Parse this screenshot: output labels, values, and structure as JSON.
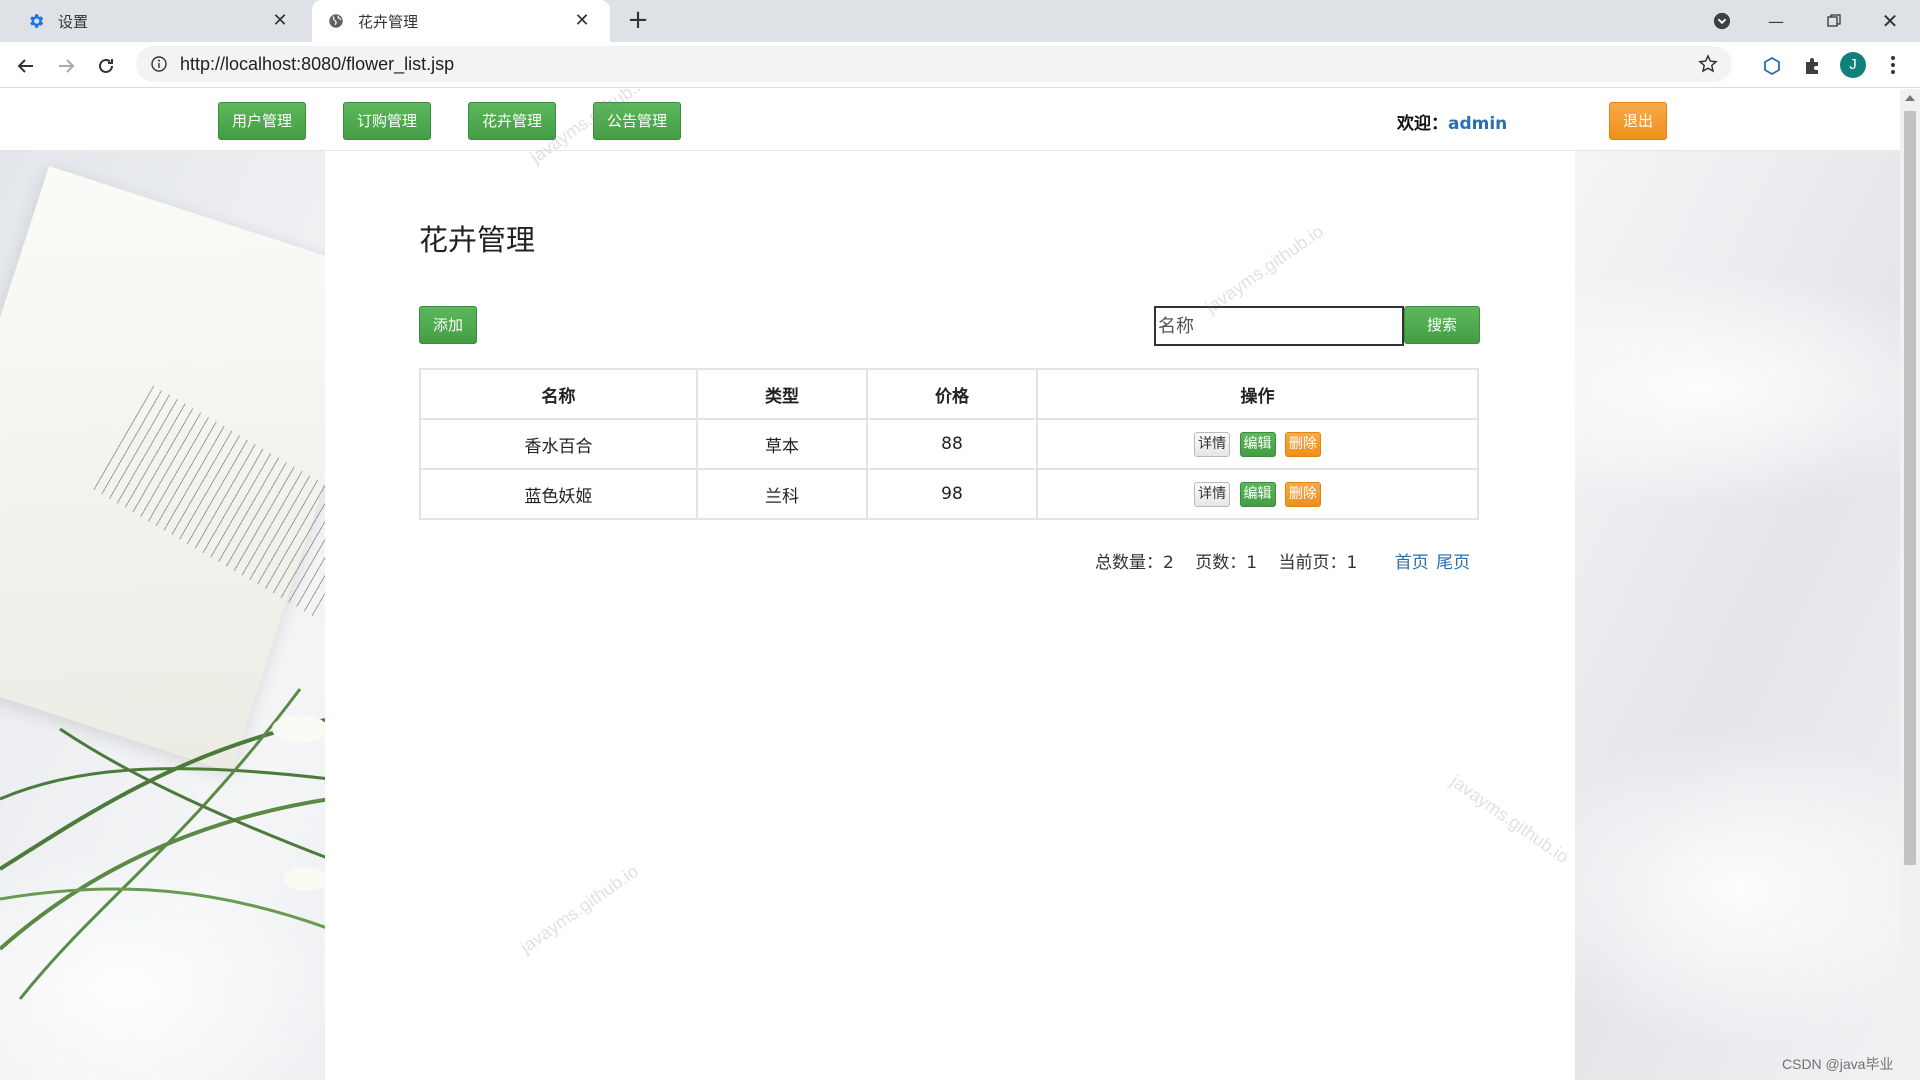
{
  "browser": {
    "tabs": [
      {
        "label": "设置",
        "icon": "gear-icon",
        "active": false
      },
      {
        "label": "花卉管理",
        "icon": "globe-icon",
        "active": true
      }
    ],
    "url": "http://localhost:8080/flower_list.jsp",
    "profile_initial": "J"
  },
  "nav": {
    "buttons": [
      "用户管理",
      "订购管理",
      "花卉管理",
      "公告管理"
    ],
    "welcome_label": "欢迎：",
    "username": "admin",
    "logout": "退出"
  },
  "page": {
    "title": "花卉管理",
    "add_button": "添加",
    "search": {
      "placeholder": "名称",
      "value": "",
      "button": "搜索"
    }
  },
  "table": {
    "headers": [
      "名称",
      "类型",
      "价格",
      "操作"
    ],
    "rows": [
      {
        "name": "香水百合",
        "type": "草本",
        "price": "88"
      },
      {
        "name": "蓝色妖姬",
        "type": "兰科",
        "price": "98"
      }
    ],
    "actions": {
      "detail": "详情",
      "edit": "编辑",
      "delete": "删除"
    }
  },
  "pager": {
    "total": "总数量：2",
    "pages": "页数：1",
    "current": "当前页：1",
    "first": "首页",
    "last": "尾页"
  },
  "watermark": "javayms.github.io",
  "footer_credit": "CSDN @java毕业",
  "colors": {
    "green": "#5cb85c",
    "orange": "#f0ad4e",
    "link": "#2a6faf"
  }
}
